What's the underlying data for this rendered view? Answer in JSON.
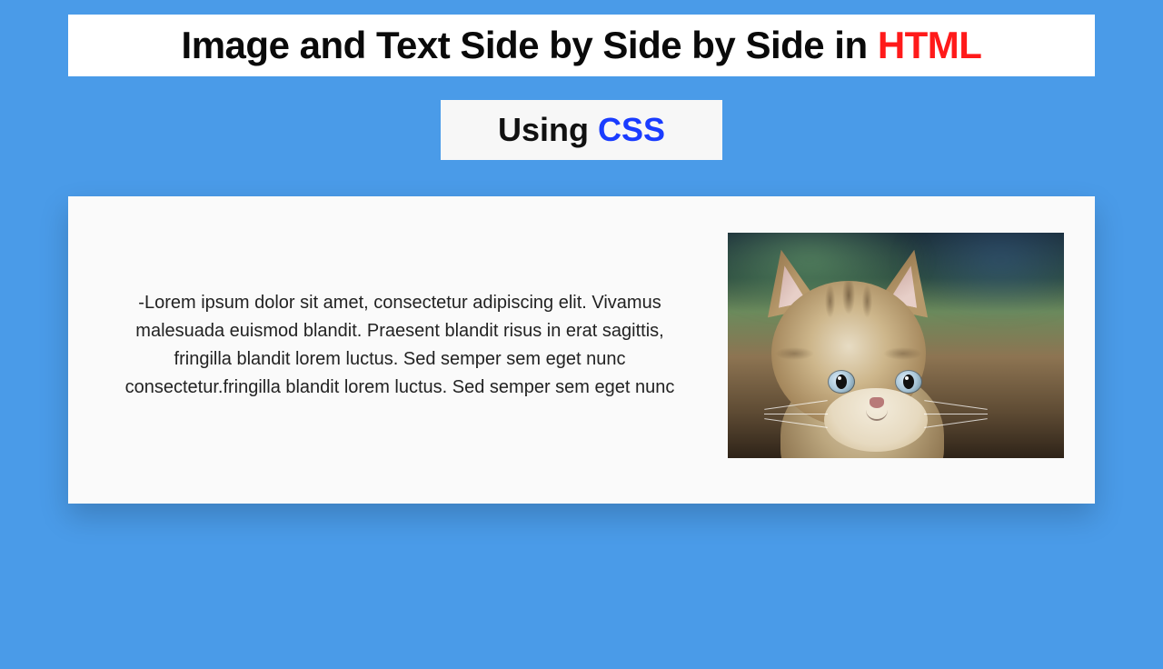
{
  "title": {
    "prefix": "Image and Text Side by Side by Side in ",
    "accent": "HTML"
  },
  "subtitle": {
    "prefix": "Using ",
    "accent": "CSS"
  },
  "card": {
    "paragraph": "-Lorem ipsum dolor sit amet, consectetur adipiscing elit. Vivamus malesuada euismod blandit. Praesent blandit risus in erat sagittis, fringilla blandit lorem luctus. Sed semper sem eget nunc consectetur.fringilla blandit lorem luctus. Sed semper sem eget nunc",
    "image_alt": "kitten"
  }
}
